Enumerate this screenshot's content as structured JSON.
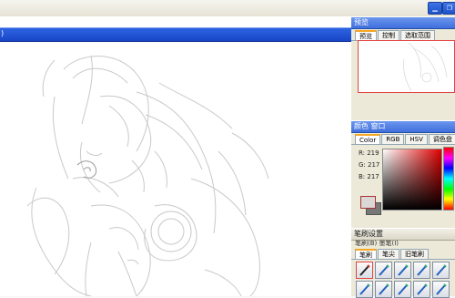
{
  "topbar": {
    "btn_a": "▁",
    "btn_b": "❐"
  },
  "document": {
    "title_fragment": ")"
  },
  "preview_panel": {
    "title": "预览",
    "tabs": [
      "预览",
      "控制",
      "选取范围"
    ]
  },
  "color_panel": {
    "title": "颜色 窗口",
    "tabs": [
      "Color",
      "RGB",
      "HSV",
      "调色盘"
    ],
    "r_label": "R: 219",
    "g_label": "G: 217",
    "b_label": "B: 217",
    "current_color": "#dbd9d9"
  },
  "brush_panel": {
    "title": "笔刷设置",
    "sub_label": "笔刷(B)   墨笔(I)",
    "tabs": [
      "笔刷",
      "笔尖",
      "旧笔刷"
    ],
    "selected_index": 0
  },
  "icons": [
    "minimize-icon",
    "restore-icon",
    "brush-icon"
  ]
}
